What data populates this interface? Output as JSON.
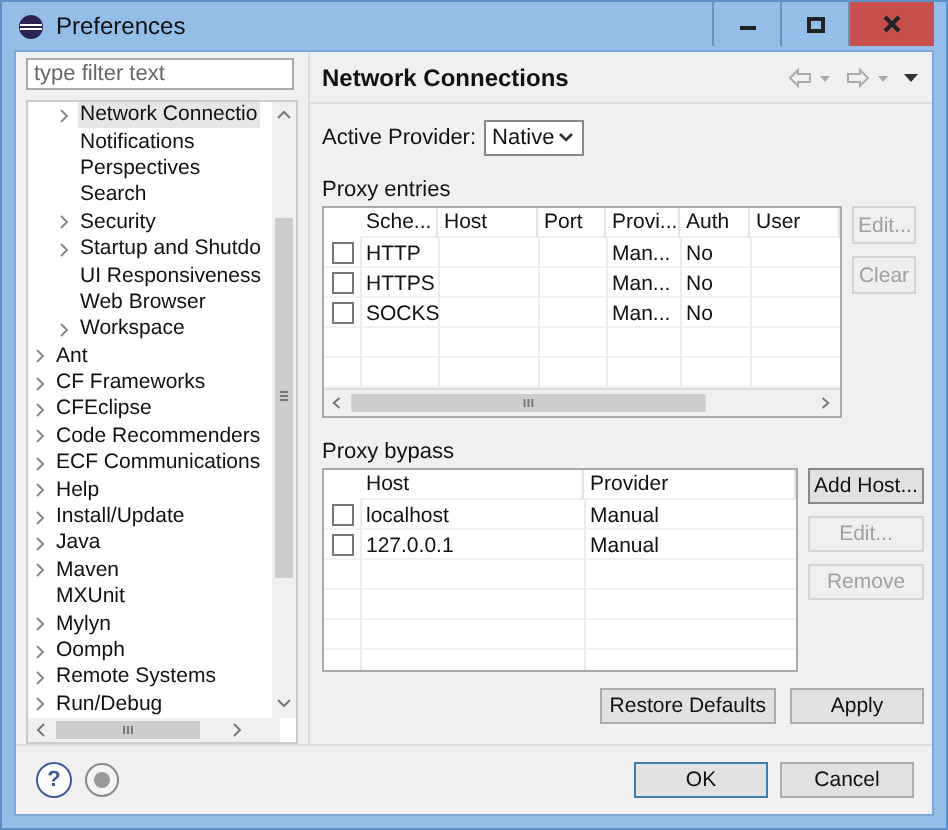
{
  "window": {
    "title": "Preferences"
  },
  "filter": {
    "placeholder": "type filter text"
  },
  "tree": {
    "continued_children": [
      {
        "label": "Network Connectio",
        "expandable": true,
        "selected": true
      },
      {
        "label": "Notifications",
        "expandable": false,
        "selected": false
      },
      {
        "label": "Perspectives",
        "expandable": false,
        "selected": false
      },
      {
        "label": "Search",
        "expandable": false,
        "selected": false
      },
      {
        "label": "Security",
        "expandable": true,
        "selected": false
      },
      {
        "label": "Startup and Shutdo",
        "expandable": true,
        "selected": false
      },
      {
        "label": "UI Responsiveness",
        "expandable": false,
        "selected": false
      },
      {
        "label": "Web Browser",
        "expandable": false,
        "selected": false
      },
      {
        "label": "Workspace",
        "expandable": true,
        "selected": false
      }
    ],
    "items": [
      {
        "label": "Ant",
        "expandable": true,
        "selected": false
      },
      {
        "label": "CF Frameworks",
        "expandable": true,
        "selected": false
      },
      {
        "label": "CFEclipse",
        "expandable": true,
        "selected": false
      },
      {
        "label": "Code Recommenders",
        "expandable": true,
        "selected": false
      },
      {
        "label": "ECF Communications",
        "expandable": true,
        "selected": false
      },
      {
        "label": "Help",
        "expandable": true,
        "selected": false
      },
      {
        "label": "Install/Update",
        "expandable": true,
        "selected": false
      },
      {
        "label": "Java",
        "expandable": true,
        "selected": false
      },
      {
        "label": "Maven",
        "expandable": true,
        "selected": false
      },
      {
        "label": "MXUnit",
        "expandable": false,
        "selected": false
      },
      {
        "label": "Mylyn",
        "expandable": true,
        "selected": false
      },
      {
        "label": "Oomph",
        "expandable": true,
        "selected": false
      },
      {
        "label": "Remote Systems",
        "expandable": true,
        "selected": false
      },
      {
        "label": "Run/Debug",
        "expandable": true,
        "selected": false
      }
    ]
  },
  "page": {
    "title": "Network Connections",
    "active_provider": {
      "label": "Active Provider:",
      "value": "Native"
    },
    "proxy_entries": {
      "label": "Proxy entries",
      "columns": [
        "Sche...",
        "Host",
        "Port",
        "Provi...",
        "Auth",
        "User"
      ],
      "rows": [
        {
          "checked": false,
          "scheme": "HTTP",
          "provider": "Man...",
          "auth": "No"
        },
        {
          "checked": false,
          "scheme": "HTTPS",
          "provider": "Man...",
          "auth": "No"
        },
        {
          "checked": false,
          "scheme": "SOCKS",
          "provider": "Man...",
          "auth": "No"
        }
      ],
      "buttons": [
        {
          "label": "Edit...",
          "disabled": true
        },
        {
          "label": "Clear",
          "disabled": true
        }
      ]
    },
    "proxy_bypass": {
      "label": "Proxy bypass",
      "columns": [
        "Host",
        "Provider"
      ],
      "rows": [
        {
          "checked": false,
          "host": "localhost",
          "provider": "Manual"
        },
        {
          "checked": false,
          "host": "127.0.0.1",
          "provider": "Manual"
        }
      ],
      "buttons": [
        {
          "label": "Add Host...",
          "disabled": false
        },
        {
          "label": "Edit...",
          "disabled": true
        },
        {
          "label": "Remove",
          "disabled": true
        }
      ]
    },
    "buttons": [
      {
        "label": "Restore Defaults"
      },
      {
        "label": "Apply"
      }
    ]
  },
  "help_button": "?",
  "dialog_buttons": [
    {
      "label": "OK"
    },
    {
      "label": "Cancel"
    }
  ]
}
